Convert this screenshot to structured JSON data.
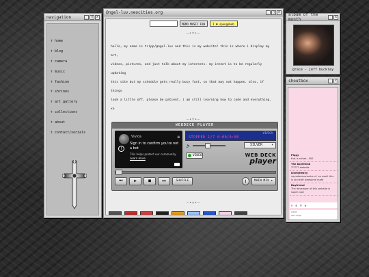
{
  "nav": {
    "title": "navigation",
    "items": [
      "home",
      "blog",
      "camera",
      "music",
      "fashion",
      "shrines",
      "art gallery",
      "collections",
      "about",
      "contact/socials"
    ]
  },
  "main": {
    "title": "@ngel-luv.neocities.org",
    "badges": [
      "",
      "MEMO MUSIC FAN",
      "I ♥ spongebob"
    ],
    "divider": "—•✝•—",
    "intro": [
      "hello, my name is tripp/@ngel.luv and this is my website! this is where i display my art,",
      "videos, pictures, and just talk about my interests. my intent is to be regularly updating",
      "this site but my schedule gets really busy fast, so that may not happen. also, if things",
      "look a little off, please be patient, i am still learning how to code and everything. xo"
    ]
  },
  "player": {
    "title": "WEBDECK PLAYER",
    "video_title": "Vivica",
    "bot_line1": "Sign in to confirm you're not a bot",
    "bot_line2": "This helps protect our community.",
    "learn_more": "Learn more",
    "lcd_top": "VIVICA",
    "lcd_status": "STOPPED 1/7 0:00/0:00",
    "skin": "SILVER",
    "video_btn": "VIDEO",
    "brand_top": "WEB DECK",
    "brand_bottom": "player",
    "controls": [
      "⏮",
      "▶",
      "■",
      "⏭"
    ],
    "shuffle": "SHUFFLE",
    "mode": "MAIN MIX"
  },
  "album": {
    "title": "album of the month",
    "caption": "grace - jeff buckley"
  },
  "shoutbox": {
    "title": "shoutbox",
    "messages": [
      {
        "name": "Pippy",
        "text": "this is a feat...500"
      },
      {
        "name": "The boyfriend",
        "text": "?????? website"
      },
      {
        "name": "lovelyheavy",
        "text": "veyedanarananha u ! so neat! this is so neat! awesome dude"
      },
      {
        "name": "Boyfriend",
        "text": "The developer of this website is super cool"
      }
    ],
    "input_placeholder": "name",
    "input_placeholder2": "message"
  },
  "colors": {
    "window_bg": "#d8d8d8",
    "lcd_bg": "#1c2f8c",
    "shout_bg": "#fbd8e5"
  }
}
